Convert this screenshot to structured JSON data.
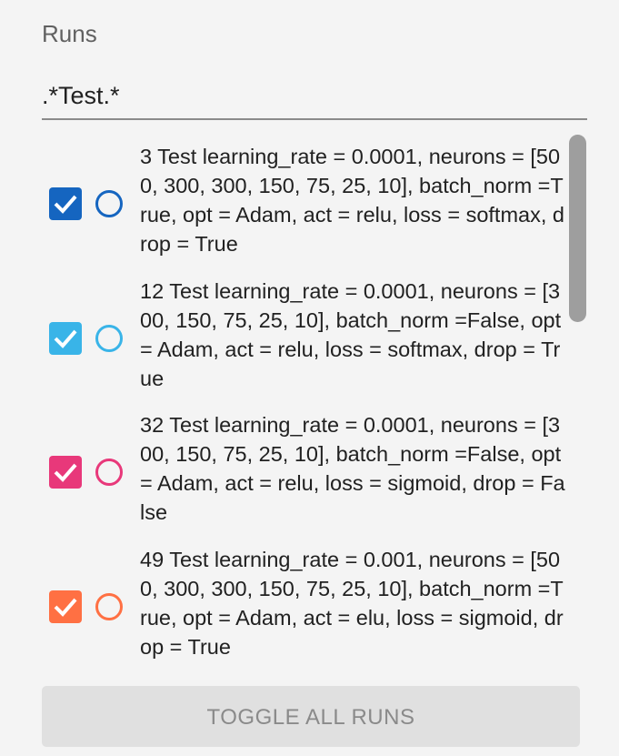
{
  "runs_panel": {
    "title": "Runs",
    "filter_value": ".*Test.*",
    "runs": [
      {
        "label": "3 Test learning_rate = 0.0001, neurons = [500, 300, 300, 150, 75, 25, 10], batch_norm =True, opt = Adam, act = relu, loss = softmax, drop = True",
        "checked": true,
        "color": "#1565c0"
      },
      {
        "label": "12 Test learning_rate = 0.0001, neurons = [300, 150, 75, 25, 10], batch_norm =False, opt = Adam, act = relu, loss = softmax, drop = True",
        "checked": true,
        "color": "#39b4e8"
      },
      {
        "label": "32 Test learning_rate = 0.0001, neurons = [300, 150, 75, 25, 10], batch_norm =False, opt = Adam, act = relu, loss = sigmoid, drop = False",
        "checked": true,
        "color": "#e8387a"
      },
      {
        "label": "49 Test learning_rate = 0.001, neurons = [500, 300, 300, 150, 75, 25, 10], batch_norm =True, opt = Adam, act = elu, loss = sigmoid, drop = True",
        "checked": true,
        "color": "#ff7043"
      }
    ],
    "toggle_all_label": "TOGGLE ALL RUNS"
  }
}
